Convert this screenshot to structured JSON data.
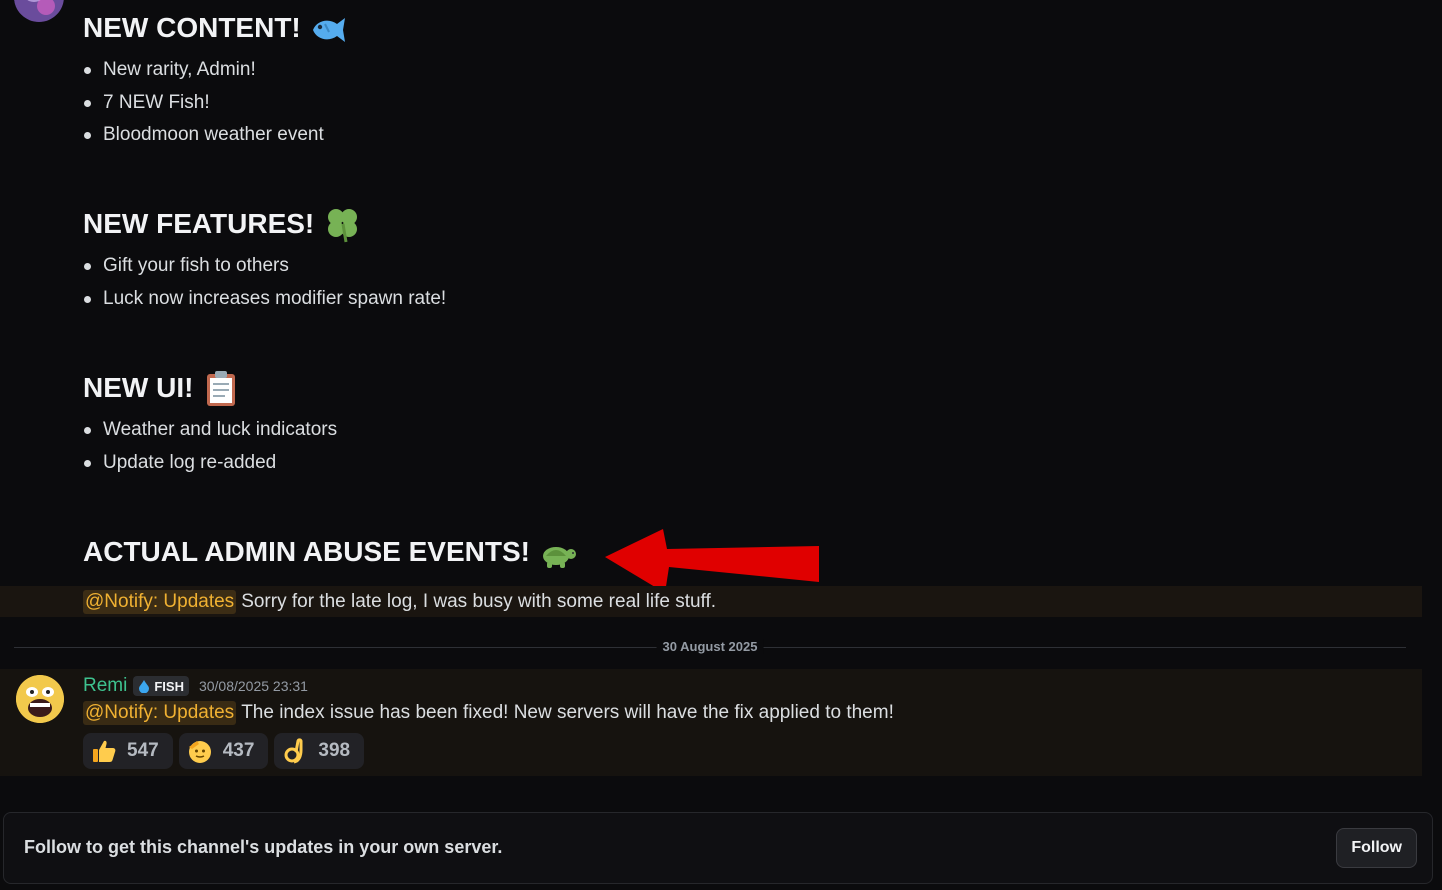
{
  "sections": [
    {
      "heading": "NEW CONTENT!",
      "emoji": "fish-emoji",
      "bullets": [
        "New rarity, Admin!",
        "7 NEW Fish!",
        "Bloodmoon weather event"
      ]
    },
    {
      "heading": "NEW FEATURES!",
      "emoji": "four-leaf-clover-emoji",
      "bullets": [
        "Gift your fish to others",
        "Luck now increases modifier spawn rate!"
      ]
    },
    {
      "heading": "NEW UI!",
      "emoji": "clipboard-emoji",
      "bullets": [
        "Weather and luck indicators",
        "Update log re-added"
      ]
    },
    {
      "heading": "ACTUAL ADMIN ABUSE EVENTS!",
      "emoji": "turtle-emoji",
      "bullets": []
    }
  ],
  "first_message": {
    "mention": "@Notify: Updates",
    "text": "Sorry for the late log, I was busy with some real life stuff."
  },
  "date_divider": "30 August 2025",
  "second_message": {
    "username": "Remi",
    "username_color": "#3ec28f",
    "tag": "FISH",
    "tag_icon": "water-drop-icon",
    "timestamp": "30/08/2025 23:31",
    "mention": "@Notify: Updates",
    "text": "The index issue has been fixed! New servers will have the fix applied to them!",
    "reactions": [
      {
        "emoji": "thumbs-up-emoji",
        "count": "547"
      },
      {
        "emoji": "saluting-face-emoji",
        "count": "437"
      },
      {
        "emoji": "ok-hand-emoji",
        "count": "398"
      }
    ]
  },
  "follow_bar": {
    "text": "Follow to get this channel's updates in your own server.",
    "button_label": "Follow"
  },
  "colors": {
    "background": "#0b0b0d",
    "mention": "#f0b132",
    "annotation_arrow": "#e00000"
  }
}
